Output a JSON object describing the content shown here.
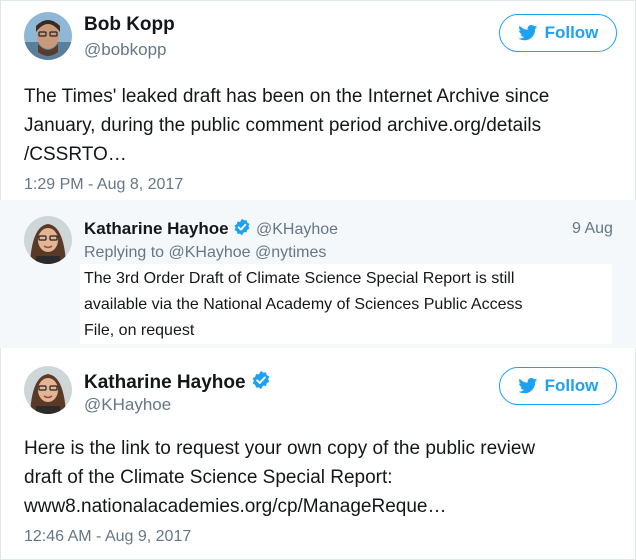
{
  "tweet1": {
    "name": "Bob Kopp",
    "handle": "@bobkopp",
    "follow_label": "Follow",
    "text_lines": [
      "The Times' leaked draft has been on the Internet Archive since",
      "January, during the public comment period archive.org/details",
      "/CSSRTO…"
    ],
    "timestamp": "1:29 PM - Aug 8, 2017"
  },
  "quoted": {
    "name": "Katharine Hayhoe",
    "handle": "@KHayhoe",
    "date": "9 Aug",
    "replying_to": "Replying to @KHayhoe @nytimes",
    "text_lines": [
      "The 3rd Order Draft of Climate Science Special Report is still",
      "available via the National Academy of Sciences Public Access",
      "File, on request"
    ]
  },
  "tweet2": {
    "name": "Katharine Hayhoe",
    "handle": "@KHayhoe",
    "follow_label": "Follow",
    "text_lines": [
      "Here is the link to request your own copy of the public review",
      "draft of the Climate Science Special Report:",
      "www8.nationalacademies.org/cp/ManageReque…"
    ],
    "timestamp": "12:46 AM - Aug 9, 2017"
  },
  "colors": {
    "twitter_blue": "#1da1f2",
    "secondary_text": "#657786",
    "quote_bg": "#f5f8fa"
  },
  "icons": [
    "bird-icon",
    "verified-badge-icon",
    "avatar"
  ]
}
